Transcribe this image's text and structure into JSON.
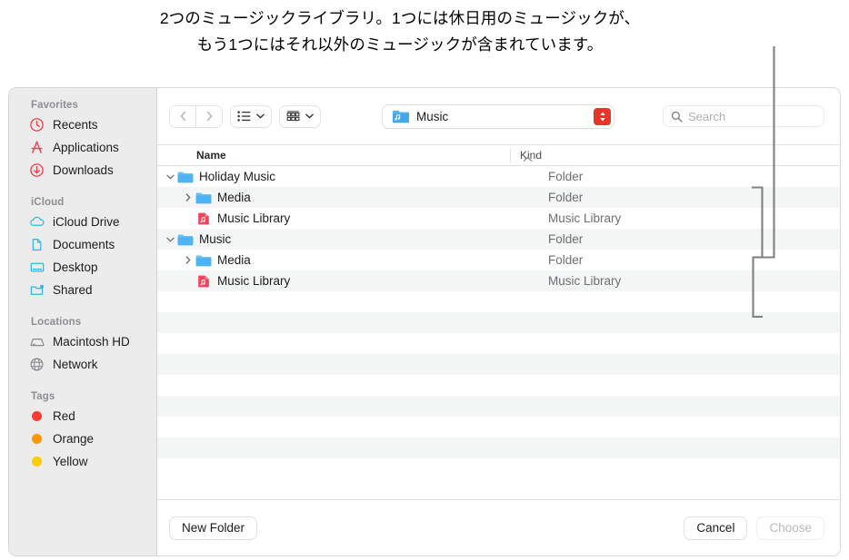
{
  "caption": {
    "text": "2つのミュージックライブラリ。1つには休日用のミュージックが、\nもう1つにはそれ以外のミュージックが含まれています。"
  },
  "sidebar": {
    "groups": [
      {
        "title": "Favorites",
        "items": [
          {
            "label": "Recents",
            "icon": "clock-icon",
            "color": "#f2384a"
          },
          {
            "label": "Applications",
            "icon": "applications-icon",
            "color": "#f2384a"
          },
          {
            "label": "Downloads",
            "icon": "download-circle-icon",
            "color": "#f2384a"
          }
        ]
      },
      {
        "title": "iCloud",
        "items": [
          {
            "label": "iCloud Drive",
            "icon": "cloud-icon",
            "color": "#35b6e4"
          },
          {
            "label": "Documents",
            "icon": "document-icon",
            "color": "#35b6e4"
          },
          {
            "label": "Desktop",
            "icon": "desktop-icon",
            "color": "#35b6e4"
          },
          {
            "label": "Shared",
            "icon": "shared-folder-icon",
            "color": "#35b6e4"
          }
        ]
      },
      {
        "title": "Locations",
        "items": [
          {
            "label": "Macintosh HD",
            "icon": "hard-disk-icon",
            "color": "#8a8a8e"
          },
          {
            "label": "Network",
            "icon": "globe-icon",
            "color": "#8a8a8e"
          }
        ]
      },
      {
        "title": "Tags",
        "items": [
          {
            "label": "Red",
            "icon": "tag-dot-icon",
            "color": "#ff3b30"
          },
          {
            "label": "Orange",
            "icon": "tag-dot-icon",
            "color": "#ff9500"
          },
          {
            "label": "Yellow",
            "icon": "tag-dot-icon",
            "color": "#ffcc00"
          }
        ]
      }
    ]
  },
  "toolbar": {
    "back_icon": "chevron-left-icon",
    "forward_icon": "chevron-right-icon",
    "view_mode_icon": "list-view-icon",
    "group_mode_icon": "grid-group-icon",
    "path_popup": {
      "label": "Music",
      "icon": "music-folder-icon",
      "stepper_icon": "up-down-stepper-icon",
      "stepper_color": "#e8342a"
    },
    "search": {
      "placeholder": "Search",
      "icon": "search-icon",
      "value": ""
    }
  },
  "columns": {
    "name": "Name",
    "kind": "Kind",
    "sort_icon": "chevron-up-icon"
  },
  "files": [
    {
      "name": "Holiday Music",
      "kind": "Folder",
      "icon": "folder-icon",
      "disclosure": "expanded",
      "depth": 0
    },
    {
      "name": "Media",
      "kind": "Folder",
      "icon": "folder-icon",
      "disclosure": "collapsed",
      "depth": 1
    },
    {
      "name": "Music Library",
      "kind": "Music Library",
      "icon": "music-library-icon",
      "disclosure": "none",
      "depth": 1
    },
    {
      "name": "Music",
      "kind": "Folder",
      "icon": "folder-icon",
      "disclosure": "expanded",
      "depth": 0
    },
    {
      "name": "Media",
      "kind": "Folder",
      "icon": "folder-icon",
      "disclosure": "collapsed",
      "depth": 1
    },
    {
      "name": "Music Library",
      "kind": "Music Library",
      "icon": "music-library-icon",
      "disclosure": "none",
      "depth": 1
    }
  ],
  "empty_row_count": 9,
  "buttons": {
    "new_folder": "New Folder",
    "cancel": "Cancel",
    "choose": "Choose",
    "choose_disabled": true
  }
}
